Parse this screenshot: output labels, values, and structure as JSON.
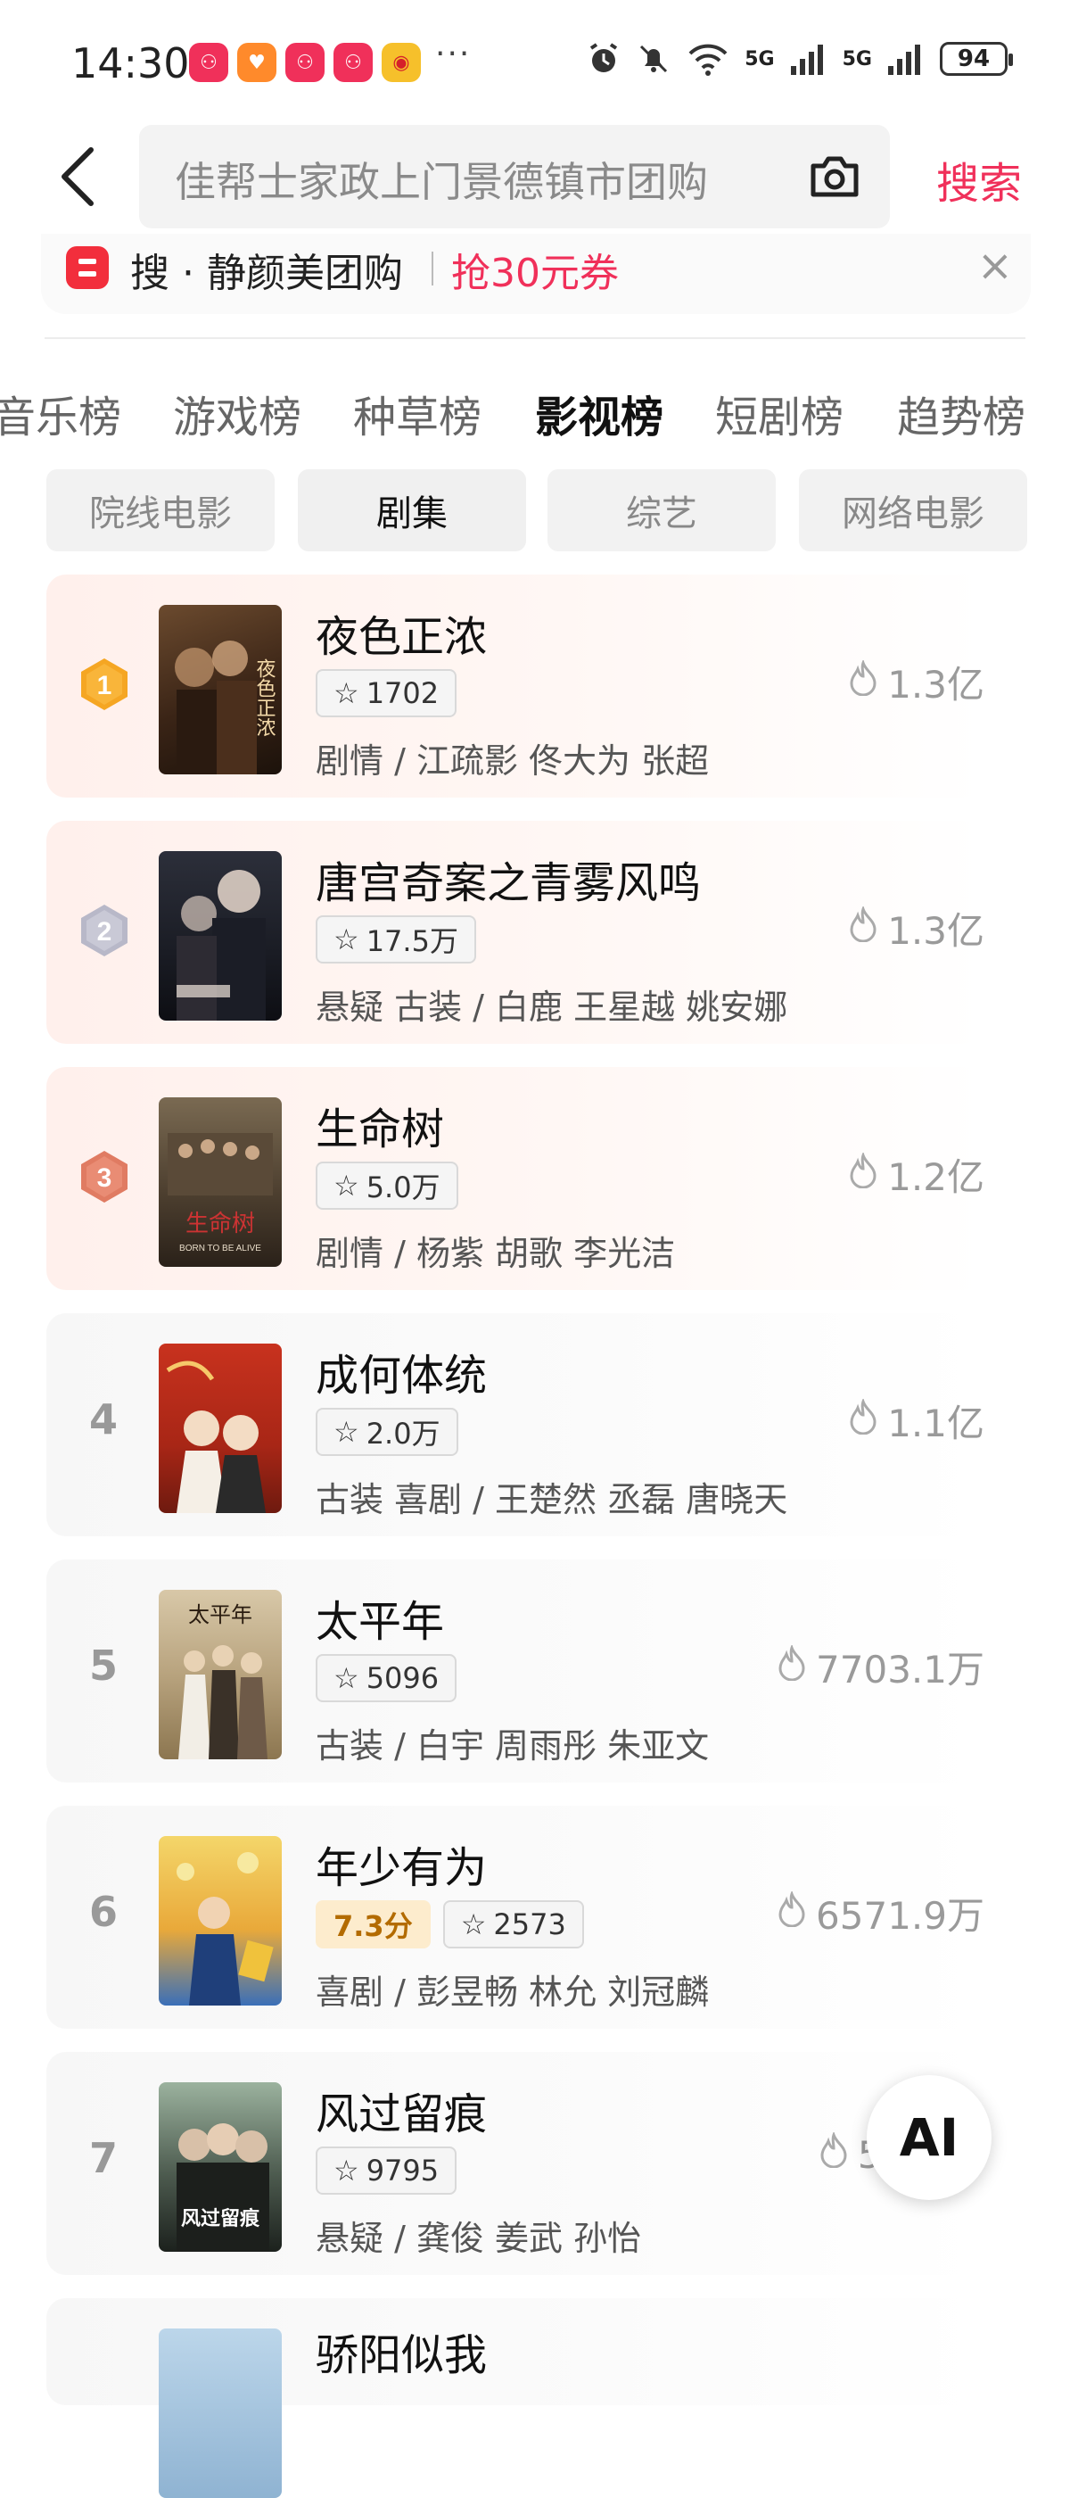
{
  "status": {
    "time": "14:30",
    "more": "···",
    "signal1": "5G",
    "signal2": "5G",
    "battery": "94"
  },
  "search": {
    "placeholder": "佳帮士家政上门景德镇市团购",
    "button": "搜索"
  },
  "promo": {
    "text": "搜 · 静颜美团购",
    "coupon": "抢30元券",
    "close": "×"
  },
  "category_tabs": [
    {
      "label": "音乐榜"
    },
    {
      "label": "游戏榜"
    },
    {
      "label": "种草榜"
    },
    {
      "label": "影视榜",
      "active": true
    },
    {
      "label": "短剧榜"
    },
    {
      "label": "趋势榜"
    }
  ],
  "sub_tabs": [
    {
      "label": "院线电影"
    },
    {
      "label": "剧集",
      "active": true
    },
    {
      "label": "综艺"
    },
    {
      "label": "网络电影"
    }
  ],
  "rankings": [
    {
      "rank": "1",
      "title": "夜色正浓",
      "stars": "1702",
      "meta": "剧情 / 江疏影 佟大为 张超",
      "heat": "1.3亿"
    },
    {
      "rank": "2",
      "title": "唐宫奇案之青雾风鸣",
      "stars": "17.5万",
      "meta": "悬疑 古装 / 白鹿 王星越 姚安娜",
      "heat": "1.3亿"
    },
    {
      "rank": "3",
      "title": "生命树",
      "stars": "5.0万",
      "meta": "剧情 / 杨紫 胡歌 李光洁",
      "heat": "1.2亿"
    },
    {
      "rank": "4",
      "title": "成何体统",
      "stars": "2.0万",
      "meta": "古装 喜剧 / 王楚然 丞磊 唐晓天",
      "heat": "1.1亿"
    },
    {
      "rank": "5",
      "title": "太平年",
      "stars": "5096",
      "meta": "古装 / 白宇 周雨彤 朱亚文",
      "heat": "7703.1万"
    },
    {
      "rank": "6",
      "title": "年少有为",
      "score": "7.3分",
      "stars": "2573",
      "meta": "喜剧 / 彭昱畅 林允 刘冠麟",
      "heat": "6571.9万"
    },
    {
      "rank": "7",
      "title": "风过留痕",
      "stars": "9795",
      "meta": "悬疑 / 龚俊 姜武 孙怡",
      "heat": "583"
    },
    {
      "rank": "8",
      "title": "骄阳似我"
    }
  ],
  "poster_text": {
    "p1": "夜色正浓",
    "p3": "生命树",
    "p3_sub": "BORN TO BE ALIVE",
    "p5": "太平年",
    "p7": "风过留痕"
  },
  "ai_button": "AI",
  "colors": {
    "accent": "#f0305a",
    "gold_medal": "#f5a623",
    "silver_medal": "#b8b8c8",
    "bronze_medal": "#e07b62"
  }
}
